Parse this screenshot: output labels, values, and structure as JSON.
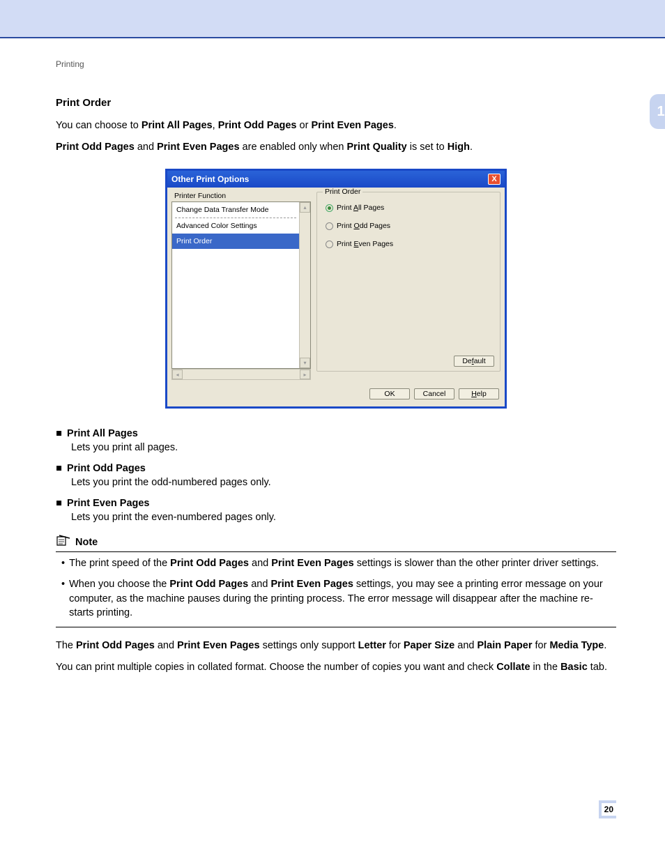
{
  "section_label": "Printing",
  "chapter_num": "1",
  "page_num": "20",
  "heading": "Print Order",
  "intro_parts": {
    "t1": "You can choose to ",
    "b1": "Print All Pages",
    "t2": ", ",
    "b2": "Print Odd Pages",
    "t3": " or ",
    "b3": "Print Even Pages",
    "t4": "."
  },
  "intro2": {
    "b1": "Print Odd Pages",
    "t1": " and ",
    "b2": "Print Even Pages",
    "t2": " are enabled only when ",
    "b3": "Print Quality",
    "t3": " is set to ",
    "b4": "High",
    "t4": "."
  },
  "dialog": {
    "title": "Other Print Options",
    "close": "X",
    "left_label": "Printer Function",
    "items": {
      "i0": "Change Data Transfer Mode",
      "i1": "Advanced Color Settings",
      "i2": "Print Order"
    },
    "group_title": "Print Order",
    "radios": {
      "r0_pre": "Print ",
      "r0_u": "A",
      "r0_post": "ll Pages",
      "r1_pre": "Print ",
      "r1_u": "O",
      "r1_post": "dd Pages",
      "r2_pre": "Print ",
      "r2_u": "E",
      "r2_post": "ven Pages"
    },
    "buttons": {
      "default_pre": "De",
      "default_u": "f",
      "default_post": "ault",
      "ok": "OK",
      "cancel": "Cancel",
      "help_u": "H",
      "help_post": "elp"
    }
  },
  "options": {
    "o0_title": "Print All Pages",
    "o0_desc": "Lets you print all pages.",
    "o1_title": "Print Odd Pages",
    "o1_desc": "Lets you print the odd-numbered pages only.",
    "o2_title": "Print Even Pages",
    "o2_desc": "Lets you print the even-numbered pages only."
  },
  "note_label": "Note",
  "notes": {
    "n0_t1": "The print speed of the ",
    "n0_b1": "Print Odd Pages",
    "n0_t2": " and ",
    "n0_b2": "Print Even Pages",
    "n0_t3": " settings is slower than the other printer driver settings.",
    "n1_t1": "When you choose the ",
    "n1_b1": "Print Odd Pages",
    "n1_t2": " and ",
    "n1_b2": "Print Even Pages",
    "n1_t3": " settings, you may see a printing error message on your computer, as the machine pauses during the printing process. The error message will disappear after the machine re-starts printing."
  },
  "post": {
    "p1_t1": "The ",
    "p1_b1": "Print Odd Pages",
    "p1_t2": " and ",
    "p1_b2": "Print Even Pages",
    "p1_t3": " settings only support ",
    "p1_b3": "Letter",
    "p1_t4": " for ",
    "p1_b4": "Paper Size",
    "p1_t5": " and ",
    "p1_b5": "Plain Paper",
    "p1_t6": " for ",
    "p1_b6": "Media Type",
    "p1_t7": ".",
    "p2_t1": "You can print multiple copies in collated format. Choose the number of copies you want and check ",
    "p2_b1": "Collate",
    "p2_t2": " in the ",
    "p2_b2": "Basic",
    "p2_t3": " tab."
  }
}
